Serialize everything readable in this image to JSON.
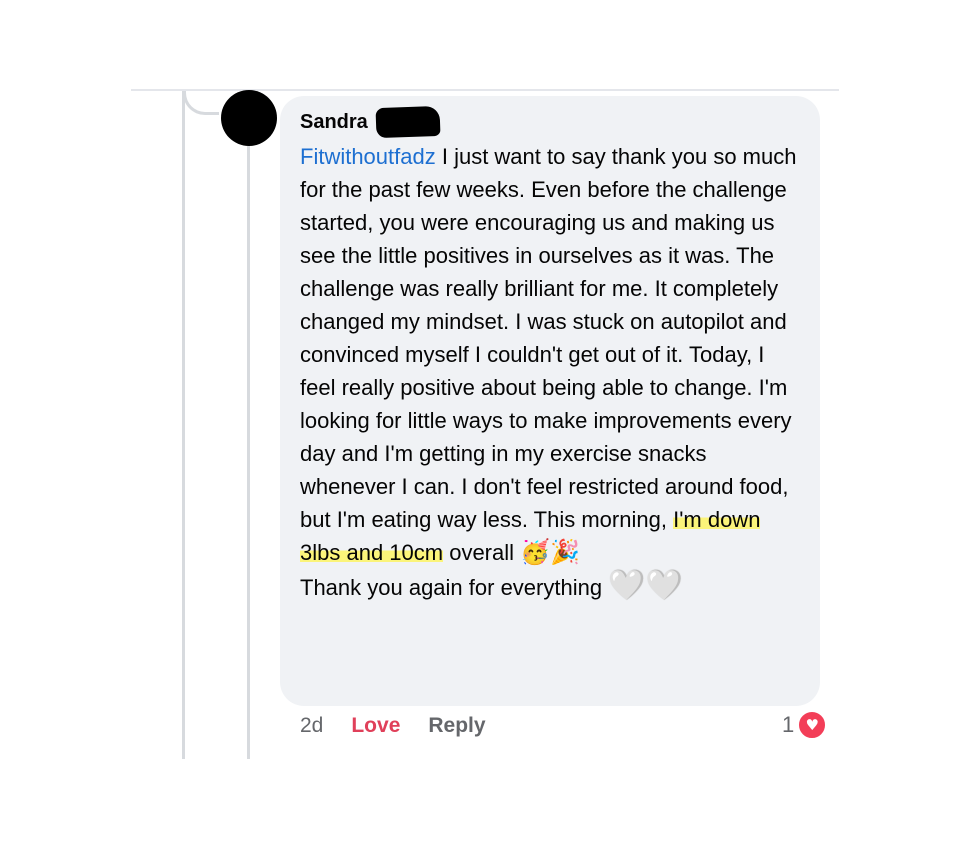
{
  "comment": {
    "author": "Sandra",
    "mention": "Fitwithoutfadz",
    "text_1": " I just want to say thank you so much for the past few weeks. Even before the challenge started, you were encouraging us and making us see the little positives in ourselves as it was. The challenge was really brilliant  for me. It completely changed my mindset. I was stuck on autopilot and convinced myself I couldn't get out of it. Today, I feel really positive about being able to change. I'm looking for little ways to make improvements every day and I'm getting in my exercise snacks whenever I can. I don't feel restricted around food, but I'm eating way less. This morning, ",
    "highlight": "I'm down 3lbs and 10cm",
    "text_2": " overall ",
    "emoji_party_face": "🥳",
    "emoji_party_popper": "🎉",
    "text_3": "Thank you again for everything ",
    "emoji_hearts": "🤍🤍"
  },
  "meta": {
    "time": "2d",
    "love_label": "Love",
    "reply_label": "Reply"
  },
  "reactions": {
    "count": "1",
    "icon": "heart-icon",
    "heart_glyph": "♥"
  },
  "colors": {
    "mention": "#1d6fd1",
    "love": "#e0405a",
    "highlight": "#fbf47a",
    "bubble": "#f0f2f5"
  }
}
